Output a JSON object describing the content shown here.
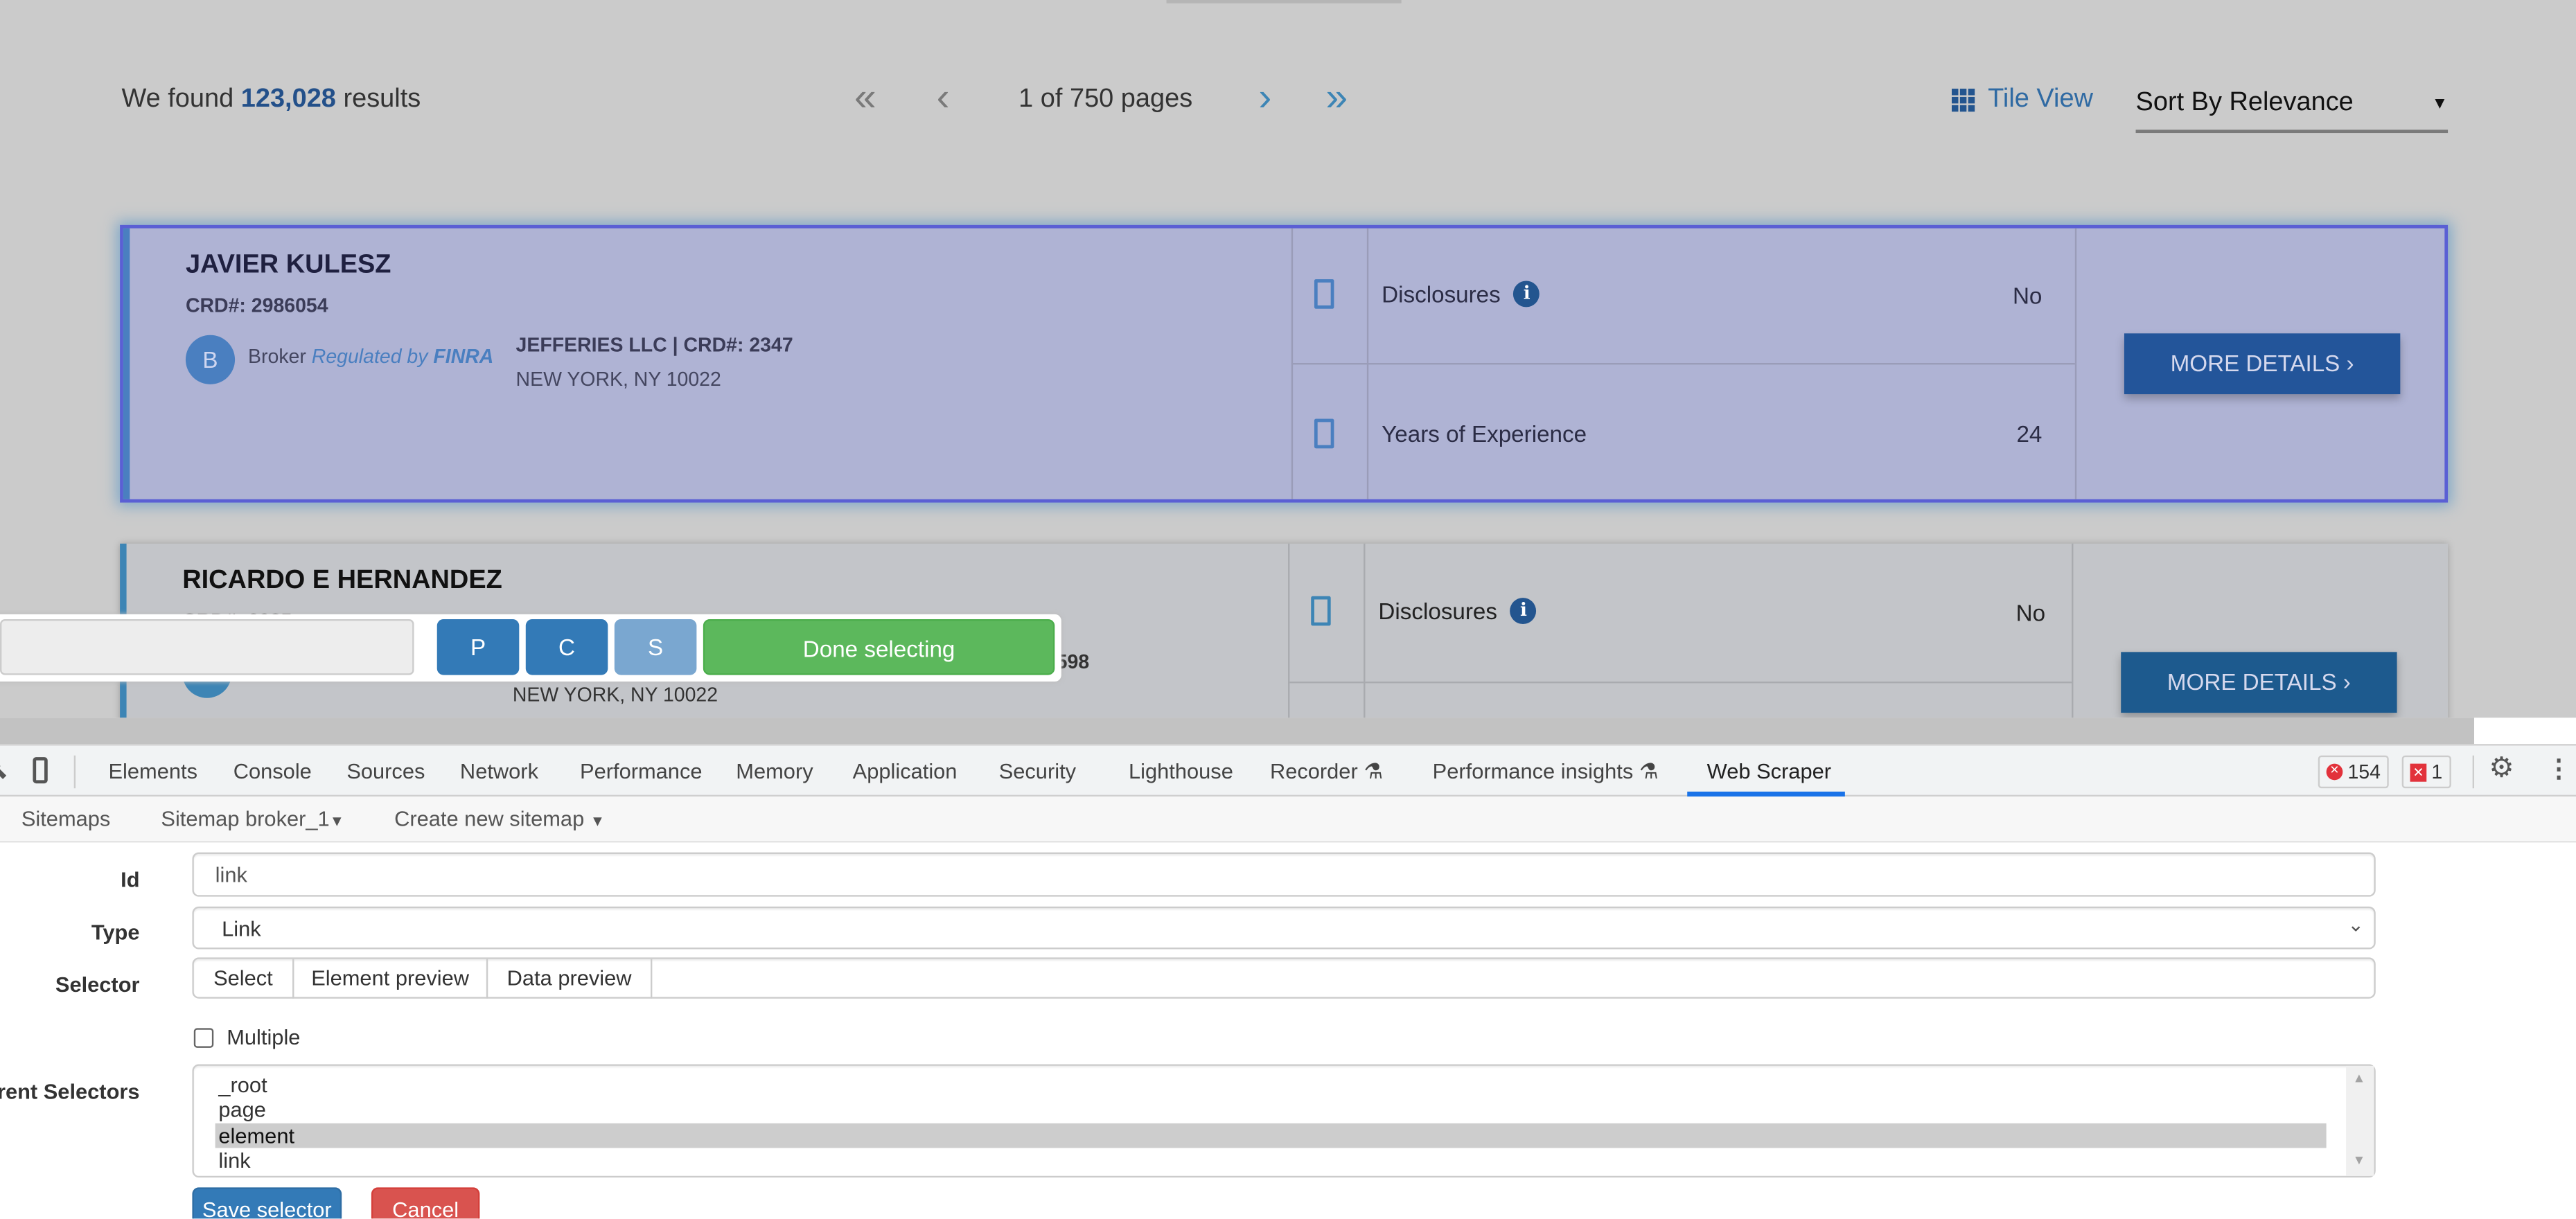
{
  "results": {
    "prefix": "We found",
    "count": "123,028",
    "suffix": "results"
  },
  "pagination": {
    "first": "«",
    "prev": "‹",
    "status": "1 of 750 pages",
    "next": "›",
    "last": "»"
  },
  "view": {
    "label": "Tile View",
    "icon": "grid-icon"
  },
  "sort": {
    "selected": "Sort By Relevance"
  },
  "cards": [
    {
      "name": "JAVIER KULESZ",
      "crd": "CRD#: 2986054",
      "badge": "B",
      "type": "Broker",
      "regulated": "Regulated by",
      "regulator": "FINRA",
      "firm": "JEFFERIES LLC | CRD#: 2347",
      "address": "NEW YORK, NY 10022",
      "disclosures_label": "Disclosures",
      "disclosures_value": "No",
      "experience_label": "Years of Experience",
      "experience_value": "24",
      "button": "MORE DETAILS ›"
    },
    {
      "name": "RICARDO E HERNANDEZ",
      "crd_partial": "CRD#: 2985...",
      "firm_partial": "598",
      "address": "NEW YORK, NY 10022",
      "disclosures_label": "Disclosures",
      "disclosures_value": "No",
      "button": "MORE DETAILS ›"
    }
  ],
  "scraper_toolbar": {
    "p": "P",
    "c": "C",
    "s": "S",
    "done": "Done selecting"
  },
  "devtools": {
    "tabs": [
      "Elements",
      "Console",
      "Sources",
      "Network",
      "Performance",
      "Memory",
      "Application",
      "Security",
      "Lighthouse",
      "Recorder",
      "Performance insights",
      "Web Scraper"
    ],
    "active_tab": "Web Scraper",
    "errors": "154",
    "issues": "1"
  },
  "subnav": {
    "sitemaps": "Sitemaps",
    "sitemap": "Sitemap broker_1",
    "create": "Create new sitemap"
  },
  "form": {
    "id_label": "Id",
    "id_value": "link",
    "type_label": "Type",
    "type_value": "Link",
    "selector_label": "Selector",
    "select_btn": "Select",
    "element_preview": "Element preview",
    "data_preview": "Data preview",
    "selector_value": "",
    "multiple_label": "Multiple",
    "multiple_checked": false,
    "parent_label": "Parent Selectors",
    "parents": [
      "_root",
      "page",
      "element",
      "link"
    ],
    "parent_selected": "element",
    "save": "Save selector",
    "cancel": "Cancel"
  },
  "colors": {
    "brand": "#23558f",
    "done": "#5cb85c",
    "save": "#337ab7",
    "cancel": "#d9534f",
    "active_tab": "#1a73e8"
  }
}
